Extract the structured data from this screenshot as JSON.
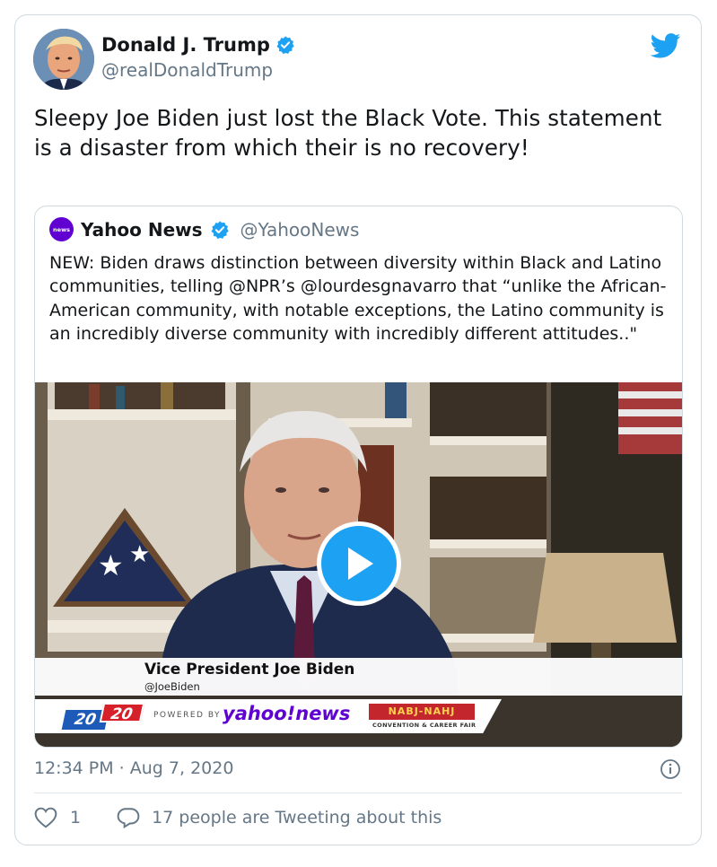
{
  "tweet": {
    "author_name": "Donald J. Trump",
    "author_handle": "@realDonaldTrump",
    "text": "Sleepy Joe Biden just lost the Black Vote. This statement is a disaster from which their is no recovery!",
    "timestamp": "12:34 PM · Aug 7, 2020",
    "like_count": "1",
    "conversation_text": "17 people are Tweeting about this"
  },
  "quoted": {
    "author_name": "Yahoo News",
    "author_handle": "@YahooNews",
    "avatar_text": "news",
    "text": "NEW: Biden draws distinction between diversity within Black and Latino communities, telling @NPR’s @lourdesgnavarro that “unlike the African-American community, with notable exceptions, the Latino community is an incredibly diverse community with incredibly different attitudes..\"",
    "video": {
      "lower_third_name": "Vice President Joe Biden",
      "lower_third_handle": "@JoeBiden",
      "logo_2020_a": "20",
      "logo_2020_b": "20",
      "powered_by": "POWERED BY",
      "yahoo_news": "yahoo!news",
      "nabj": "NABJ-NAHJ",
      "nabj_sub": "CONVENTION & CAREER FAIR"
    }
  },
  "icons": {
    "bird": "twitter-bird-icon",
    "verified": "verified-badge-icon",
    "play": "play-icon",
    "info": "info-icon",
    "like": "heart-icon",
    "reply": "reply-bubble-icon"
  },
  "colors": {
    "accent": "#1da1f2",
    "muted": "#657786",
    "border": "#cfd9de",
    "yahoo_purple": "#6001d2"
  }
}
